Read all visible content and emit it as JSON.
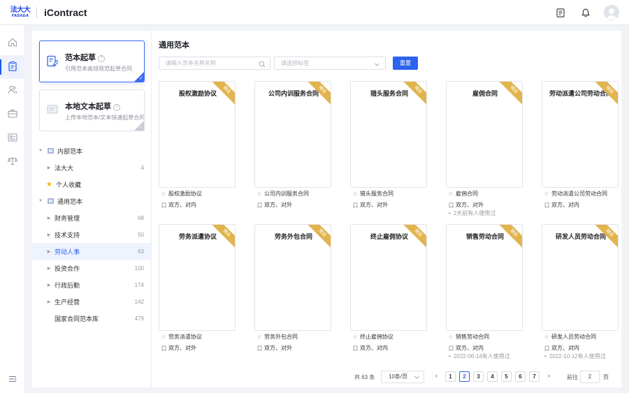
{
  "header": {
    "logo_cn": "法大大",
    "logo_en": "FADADA",
    "app_title": "iContract"
  },
  "sidebar": {
    "draft_cards": [
      {
        "title": "范本起草",
        "subtitle": "引用范本高效规范起草合同",
        "selected": true
      },
      {
        "title": "本地文本起草",
        "subtitle": "上传本地范本/文本快速起草合同",
        "selected": false
      }
    ],
    "tree": [
      {
        "label": "内部范本",
        "level": 0,
        "expanded": true,
        "count": ""
      },
      {
        "label": "法大大",
        "level": 1,
        "count": "4"
      },
      {
        "label": "个人收藏",
        "level": 1,
        "count": ""
      },
      {
        "label": "通用范本",
        "level": 0,
        "expanded": true,
        "count": ""
      },
      {
        "label": "财务管理",
        "level": 1,
        "count": "68"
      },
      {
        "label": "技术支持",
        "level": 1,
        "count": "50"
      },
      {
        "label": "劳动人事",
        "level": 1,
        "count": "63",
        "selected": true
      },
      {
        "label": "投资合作",
        "level": 1,
        "count": "100"
      },
      {
        "label": "行政后勤",
        "level": 1,
        "count": "174"
      },
      {
        "label": "生产经营",
        "level": 1,
        "count": "142"
      },
      {
        "label": "国家合同范本库",
        "level": 1,
        "count": "479"
      }
    ]
  },
  "main": {
    "title": "通用范本",
    "search_placeholder": "请输入范本名称名称",
    "tag_placeholder": "请选择标签",
    "reset_label": "重置",
    "ribbon_label": "精选",
    "templates": [
      {
        "title": "股权激励协议",
        "name": "股权激励协议",
        "parties": "双方、对内",
        "used": ""
      },
      {
        "title": "公司内训服务合同",
        "name": "公司内训服务合同",
        "parties": "双方、对外",
        "used": ""
      },
      {
        "title": "猎头服务合同",
        "name": "猎头服务合同",
        "parties": "双方、对外",
        "used": ""
      },
      {
        "title": "雇佣合同",
        "name": "雇佣合同",
        "parties": "双方、对外",
        "used": "2天前有人使用过"
      },
      {
        "title": "劳动派遣公司劳动合同",
        "name": "劳动派遣公司劳动合同",
        "parties": "双方、对内",
        "used": ""
      },
      {
        "title": "劳务派遣协议",
        "name": "劳务派遣协议",
        "parties": "双方、对外",
        "used": ""
      },
      {
        "title": "劳务外包合同",
        "name": "劳务外包合同",
        "parties": "双方、对外",
        "used": ""
      },
      {
        "title": "终止雇佣协议",
        "name": "终止雇佣协议",
        "parties": "双方、对内",
        "used": ""
      },
      {
        "title": "销售劳动合同",
        "name": "销售劳动合同",
        "parties": "双方、对内",
        "used": "2022-06-14有人使用过"
      },
      {
        "title": "研发人员劳动合同",
        "name": "研发人员劳动合同",
        "parties": "双方、对内",
        "used": "2022-10-12有人使用过"
      }
    ]
  },
  "pagination": {
    "total": "共 63 条",
    "page_size": "10条/页",
    "prev": "‹",
    "next": "›",
    "pages": [
      "1",
      "2",
      "3",
      "4",
      "5",
      "6",
      "7"
    ],
    "current": "2",
    "goto_label": "前往",
    "goto_value": "2",
    "page_unit": "页"
  },
  "colors": {
    "accent": "#2e63ef",
    "ribbon": "#e2b44e",
    "selected_bg": "#eef3fe"
  },
  "icons": {
    "rail": [
      "home-icon",
      "contract-icon",
      "users-icon",
      "briefcase-icon",
      "id-card-icon",
      "scale-icon"
    ],
    "top": [
      "document-list-icon",
      "bell-icon",
      "avatar"
    ]
  }
}
